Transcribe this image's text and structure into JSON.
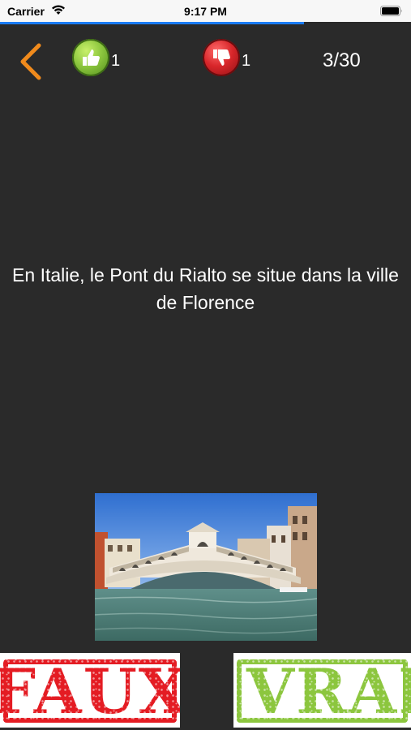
{
  "status_bar": {
    "carrier": "Carrier",
    "time": "9:17 PM"
  },
  "progress": {
    "fraction": 0.74,
    "color": "#1a7cf5"
  },
  "header": {
    "back_icon": "chevron-left-icon",
    "correct_icon": "thumbs-up-icon",
    "correct_count": "1",
    "wrong_icon": "thumbs-down-icon",
    "wrong_count": "1",
    "question_counter": "3/30"
  },
  "question": {
    "text": "En Italie, le Pont du Rialto se situe dans la ville de Florence"
  },
  "image": {
    "subject": "rialto-bridge-photo"
  },
  "answers": {
    "false_label": "FAUX",
    "true_label": "VRAI",
    "false_color": "#e41c23",
    "true_color": "#8cc63e"
  },
  "colors": {
    "background": "#2a2a2a",
    "accent": "#f08a1c"
  }
}
